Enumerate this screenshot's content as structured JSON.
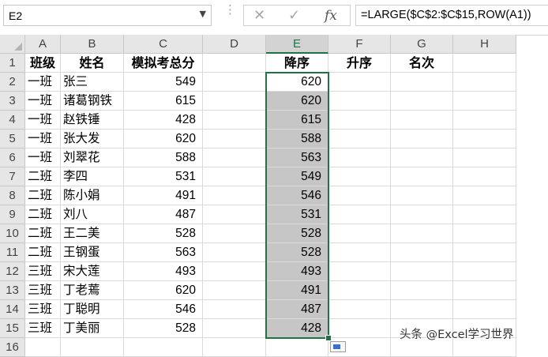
{
  "name_box": {
    "value": "E2"
  },
  "formula": {
    "fx_label": "fx",
    "text": "=LARGE($C$2:$C$15,ROW(A1))"
  },
  "columns": [
    "A",
    "B",
    "C",
    "D",
    "E",
    "F",
    "G",
    "H"
  ],
  "selected_column": "E",
  "rows": [
    "1",
    "2",
    "3",
    "4",
    "5",
    "6",
    "7",
    "8",
    "9",
    "10",
    "11",
    "12",
    "13",
    "14",
    "15",
    "16"
  ],
  "header_row": {
    "A": "班级",
    "B": "姓名",
    "C": "模拟考总分",
    "D": "",
    "E": "降序",
    "F": "升序",
    "G": "名次"
  },
  "data_rows": [
    {
      "A": "一班",
      "B": "张三",
      "C": "549",
      "E": "620"
    },
    {
      "A": "一班",
      "B": "诸葛钢铁",
      "C": "615",
      "E": "620"
    },
    {
      "A": "一班",
      "B": "赵铁锤",
      "C": "428",
      "E": "615"
    },
    {
      "A": "一班",
      "B": "张大发",
      "C": "620",
      "E": "588"
    },
    {
      "A": "一班",
      "B": "刘翠花",
      "C": "588",
      "E": "563"
    },
    {
      "A": "二班",
      "B": "李四",
      "C": "531",
      "E": "549"
    },
    {
      "A": "二班",
      "B": "陈小娟",
      "C": "491",
      "E": "546"
    },
    {
      "A": "二班",
      "B": "刘八",
      "C": "487",
      "E": "531"
    },
    {
      "A": "二班",
      "B": "王二美",
      "C": "528",
      "E": "528"
    },
    {
      "A": "二班",
      "B": "王钢蛋",
      "C": "563",
      "E": "528"
    },
    {
      "A": "三班",
      "B": "宋大莲",
      "C": "493",
      "E": "493"
    },
    {
      "A": "三班",
      "B": "丁老蔫",
      "C": "620",
      "E": "491"
    },
    {
      "A": "三班",
      "B": "丁聪明",
      "C": "546",
      "E": "487"
    },
    {
      "A": "三班",
      "B": "丁美丽",
      "C": "528",
      "E": "428"
    }
  ],
  "watermark": "头条 @Excel学习世界",
  "icons": {
    "name_box_dropdown": "chevron-down-icon",
    "cancel": "close-icon",
    "enter": "check-icon",
    "insert_function": "fx-icon",
    "quick_analysis": "quick-analysis-icon"
  },
  "colors": {
    "selection": "#217346",
    "selected_fill": "#c6c6c6",
    "header_bg": "#e6e6e6"
  }
}
